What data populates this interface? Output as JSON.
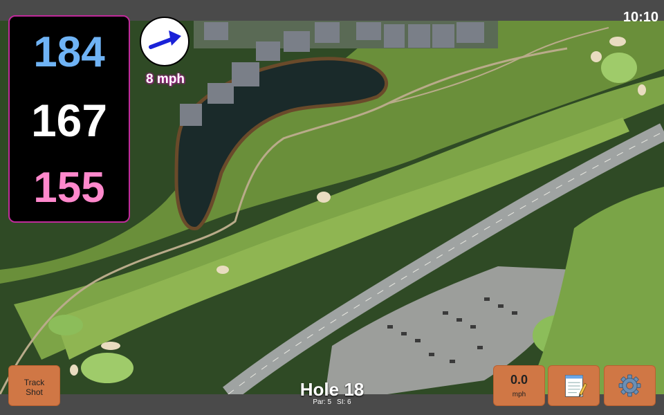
{
  "status": {
    "time": "10:10"
  },
  "distances": {
    "back": "184",
    "middle": "167",
    "front": "155"
  },
  "wind": {
    "speed": "8 mph",
    "direction_icon": "arrow-icon"
  },
  "hole": {
    "title": "Hole 18",
    "par": "Par: 5",
    "stroke_index": "SI: 6"
  },
  "buttons": {
    "track_shot_line1": "Track",
    "track_shot_line2": "Shot",
    "speed_value": "0.0",
    "speed_unit": "mph",
    "notes_icon": "notepad-icon",
    "settings_icon": "gear-icon"
  },
  "colors": {
    "back_distance": "#6fb3f5",
    "middle_distance": "#ffffff",
    "front_distance": "#ff88cc",
    "panel_border": "#c02a9b",
    "button": "#d07745"
  }
}
